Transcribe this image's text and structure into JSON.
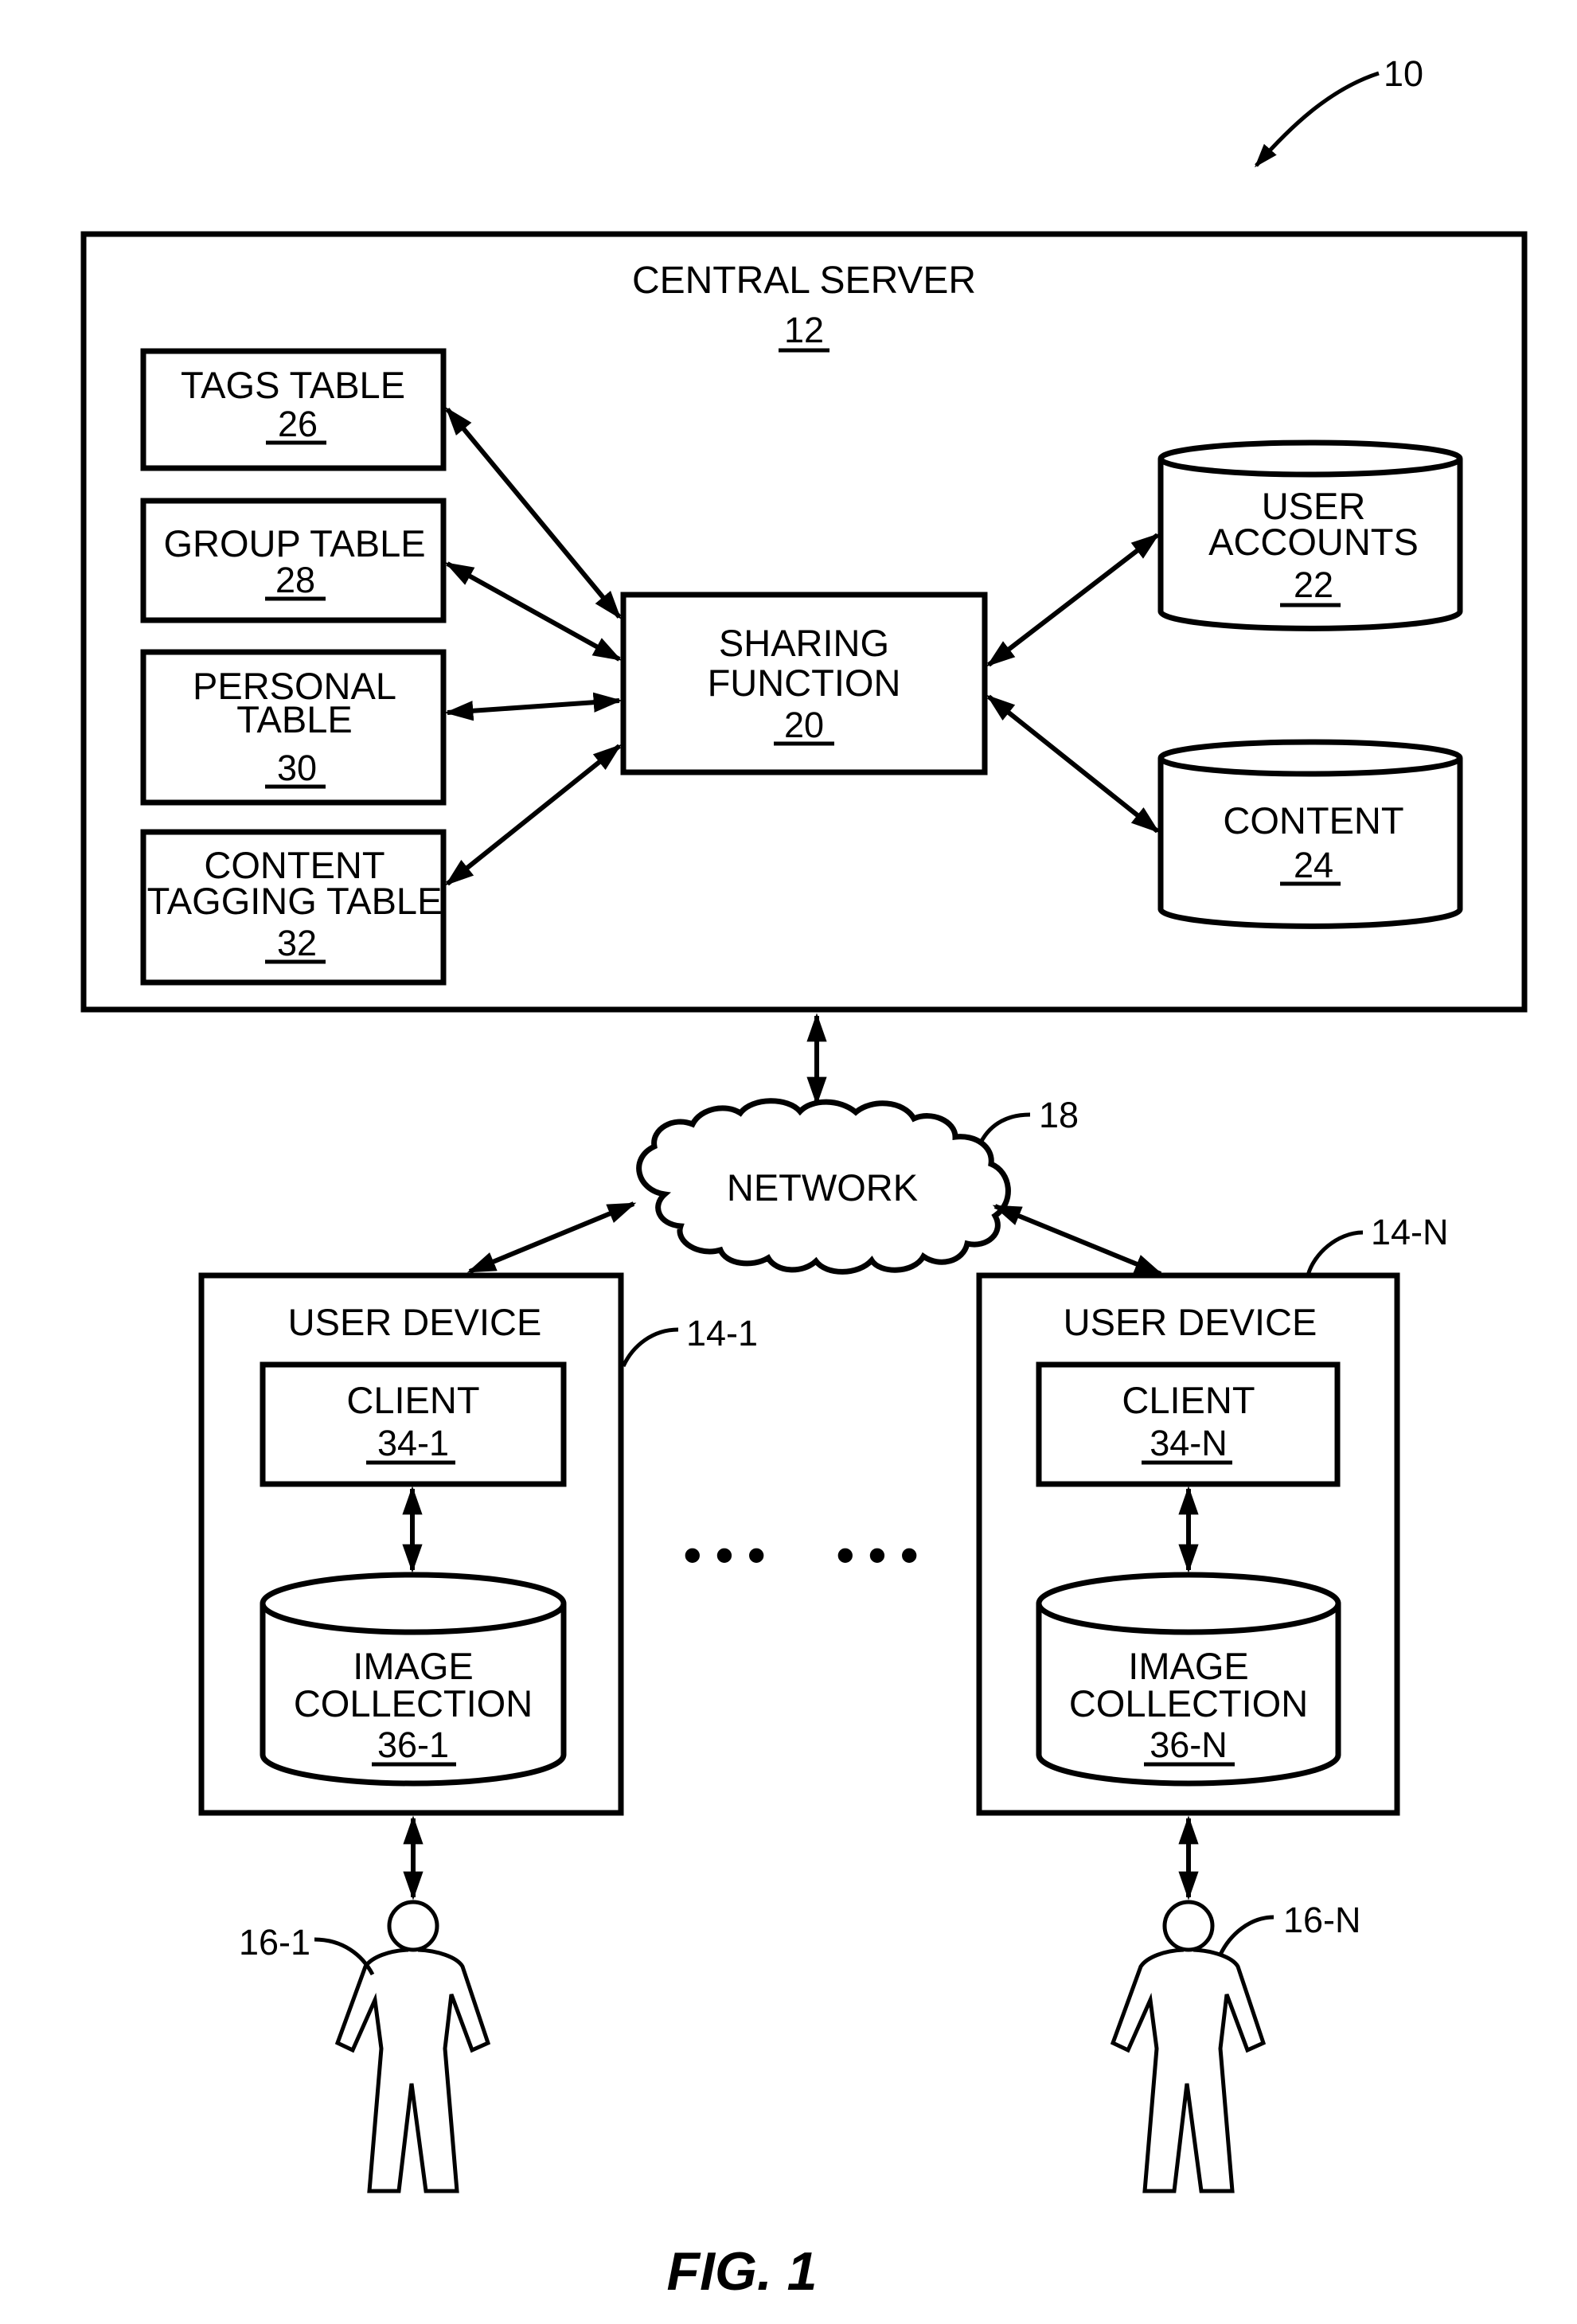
{
  "figure": {
    "label": "FIG. 1",
    "system_ref": "10"
  },
  "central_server": {
    "title": "CENTRAL SERVER",
    "ref": "12",
    "tables": [
      {
        "lines": [
          "TAGS TABLE"
        ],
        "ref": "26"
      },
      {
        "lines": [
          "GROUP TABLE"
        ],
        "ref": "28"
      },
      {
        "lines": [
          "PERSONAL",
          "TABLE"
        ],
        "ref": "30"
      },
      {
        "lines": [
          "CONTENT",
          "TAGGING TABLE"
        ],
        "ref": "32"
      }
    ],
    "sharing_function": {
      "lines": [
        "SHARING",
        "FUNCTION"
      ],
      "ref": "20"
    },
    "datastores": [
      {
        "lines": [
          "USER",
          "ACCOUNTS"
        ],
        "ref": "22"
      },
      {
        "lines": [
          "CONTENT"
        ],
        "ref": "24"
      }
    ]
  },
  "network": {
    "label": "NETWORK",
    "ref": "18"
  },
  "user_devices": [
    {
      "title": "USER DEVICE",
      "ref": "14-1",
      "client": {
        "label": "CLIENT",
        "ref": "34-1"
      },
      "collection": {
        "lines": [
          "IMAGE",
          "COLLECTION"
        ],
        "ref": "36-1"
      },
      "user_ref": "16-1"
    },
    {
      "title": "USER DEVICE",
      "ref": "14-N",
      "client": {
        "label": "CLIENT",
        "ref": "34-N"
      },
      "collection": {
        "lines": [
          "IMAGE",
          "COLLECTION"
        ],
        "ref": "36-N"
      },
      "user_ref": "16-N"
    }
  ],
  "ellipsis_groups": [
    "• • •",
    "• • •"
  ]
}
